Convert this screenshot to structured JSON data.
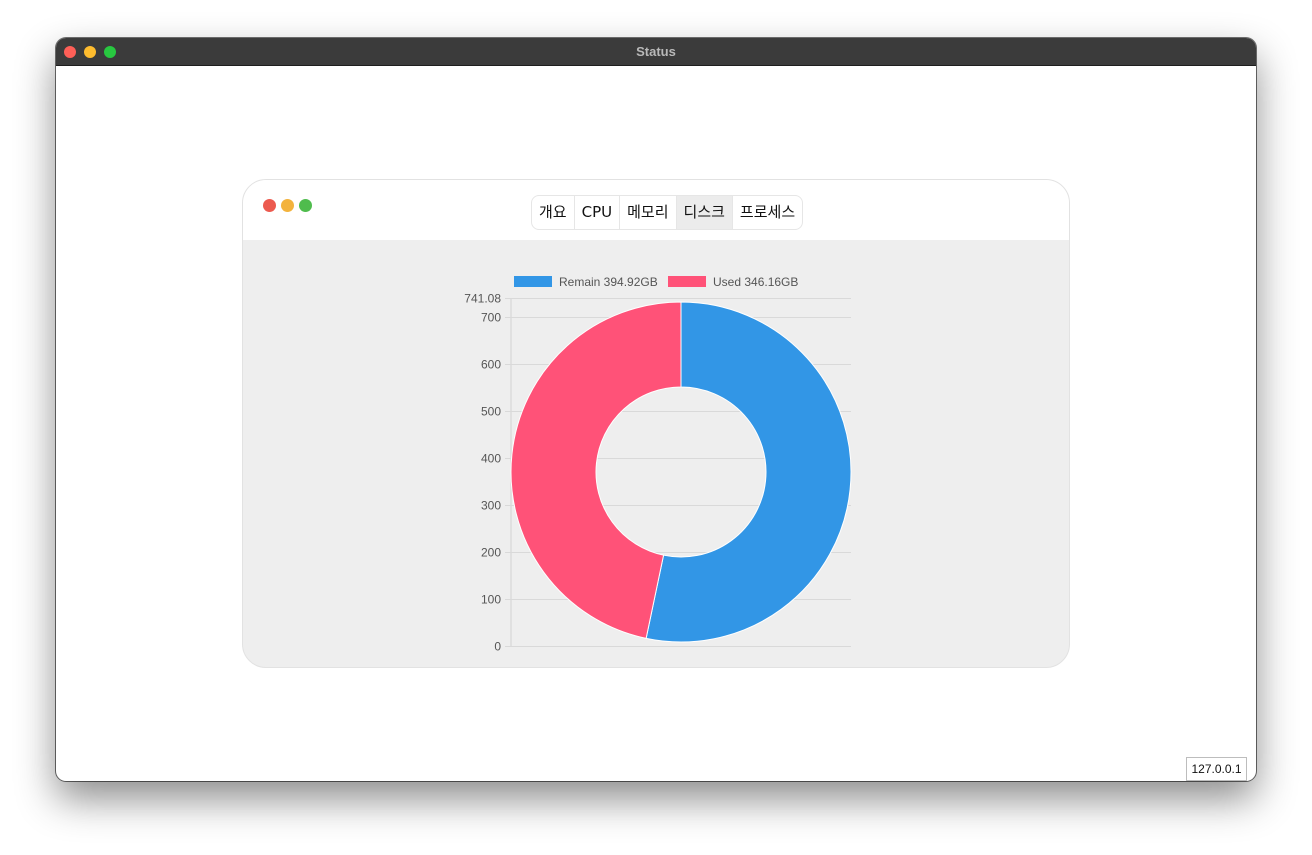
{
  "window": {
    "title": "Status"
  },
  "tabs": [
    {
      "label": "개요",
      "active": false
    },
    {
      "label": "CPU",
      "active": false
    },
    {
      "label": "메모리",
      "active": false
    },
    {
      "label": "디스크",
      "active": true
    },
    {
      "label": "프로세스",
      "active": false
    }
  ],
  "status": {
    "host": "127.0.0.1"
  },
  "colors": {
    "remain": "#3296e6",
    "used": "#ff5278"
  },
  "chart_data": {
    "type": "pie",
    "variant": "doughnut",
    "legend_position": "top",
    "grid": true,
    "labels": [
      "Remain 394.92GB",
      "Used 346.16GB"
    ],
    "values": [
      394.92,
      346.16
    ],
    "y_ticks": [
      "0",
      "100",
      "200",
      "300",
      "400",
      "500",
      "600",
      "700",
      "741.08"
    ],
    "ylim": [
      0,
      741.08
    ]
  }
}
